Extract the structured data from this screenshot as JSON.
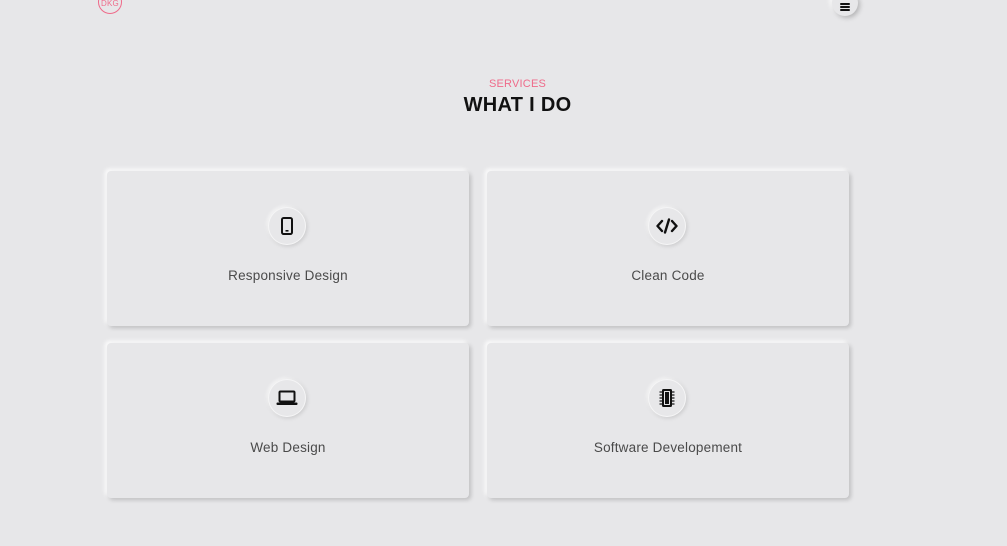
{
  "header": {
    "logo_text": "DKG",
    "menu_icon": "hamburger-menu-icon"
  },
  "section": {
    "subtitle": "SERVICES",
    "title": "WHAT I DO"
  },
  "services": [
    {
      "label": "Responsive Design",
      "icon": "mobile-phone-icon"
    },
    {
      "label": "Clean Code",
      "icon": "code-icon"
    },
    {
      "label": "Web Design",
      "icon": "laptop-icon"
    },
    {
      "label": "Software Developement",
      "icon": "microchip-icon"
    }
  ],
  "colors": {
    "background": "#e7e7e9",
    "accent": "#ef6b8a",
    "title": "#111111",
    "label": "#4a4a4a"
  }
}
